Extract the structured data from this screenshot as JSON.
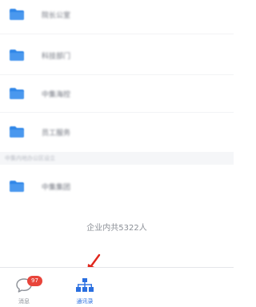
{
  "folders": [
    {
      "label": "院长公室",
      "icon": "folder-icon"
    },
    {
      "label": "科技部门",
      "icon": "folder-icon"
    },
    {
      "label": "中集海控",
      "icon": "folder-icon"
    },
    {
      "label": "员工服务",
      "icon": "folder-icon"
    },
    {
      "label": "中集集团",
      "icon": "folder-icon"
    }
  ],
  "section": {
    "label": "中集内地办公区设立"
  },
  "summary": {
    "member_count": "企业内共5322人"
  },
  "tabbar": {
    "messages": {
      "label": "消息",
      "badge": "97",
      "icon": "chat-bubble-icon"
    },
    "contacts": {
      "label": "通讯录",
      "icon": "org-chart-icon",
      "active": true
    }
  },
  "annotation": {
    "icon": "red-arrow-icon",
    "color": "#e0261c"
  },
  "colors": {
    "folder": "#2f86e8",
    "accent": "#2a6fe0",
    "badge": "#e8443a"
  }
}
